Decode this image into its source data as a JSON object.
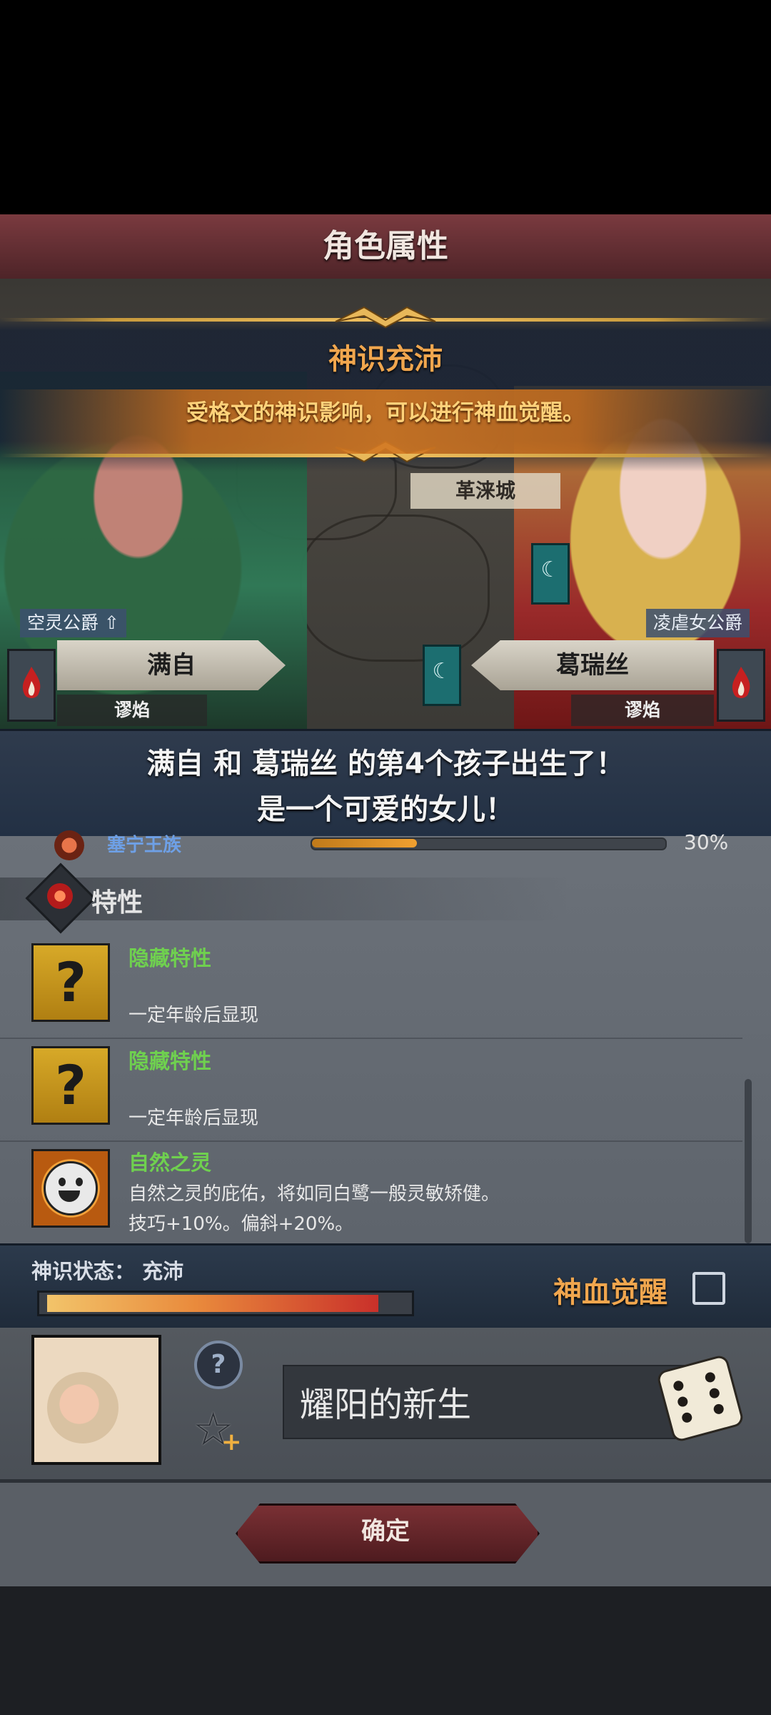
{
  "header": {
    "title": "角色属性"
  },
  "awakening_banner": {
    "title": "神识充沛",
    "description": "受格文的神识影响，可以进行神血觉醒。"
  },
  "map": {
    "city_label": "革涞城"
  },
  "father": {
    "title": "空灵公爵",
    "name": "满自",
    "house": "谬焰"
  },
  "mother": {
    "title": "凌虐女公爵",
    "name": "葛瑞丝",
    "house": "谬焰"
  },
  "birth": {
    "line1": "满自 和 葛瑞丝 的第4个孩子出生了！",
    "line2": "是一个可爱的女儿！"
  },
  "clan": {
    "name": "塞宁王族",
    "percent_label": "30%",
    "percent": 0.3
  },
  "traits_section": {
    "title": "特性",
    "items": [
      {
        "name": "隐藏特性",
        "desc1": "一定年龄后显现",
        "desc2": "",
        "icon": "question-icon"
      },
      {
        "name": "隐藏特性",
        "desc1": "一定年龄后显现",
        "desc2": "",
        "icon": "question-icon"
      },
      {
        "name": "自然之灵",
        "desc1": "自然之灵的庇佑，将如同白鹭一般灵敏矫健。",
        "desc2": "技巧+10%。偏斜+20%。",
        "icon": "smile-sun-icon"
      }
    ]
  },
  "divine_status": {
    "label": "神识状态： 充沛",
    "level": 0.94
  },
  "blood_awakening": {
    "label": "神血觉醒",
    "checked": false
  },
  "newborn": {
    "name": "耀阳的新生"
  },
  "confirm_label": "确定",
  "colors": {
    "accent_orange": "#f0a64e",
    "trait_green": "#6fd04f",
    "header_red": "#7a3a3f"
  }
}
